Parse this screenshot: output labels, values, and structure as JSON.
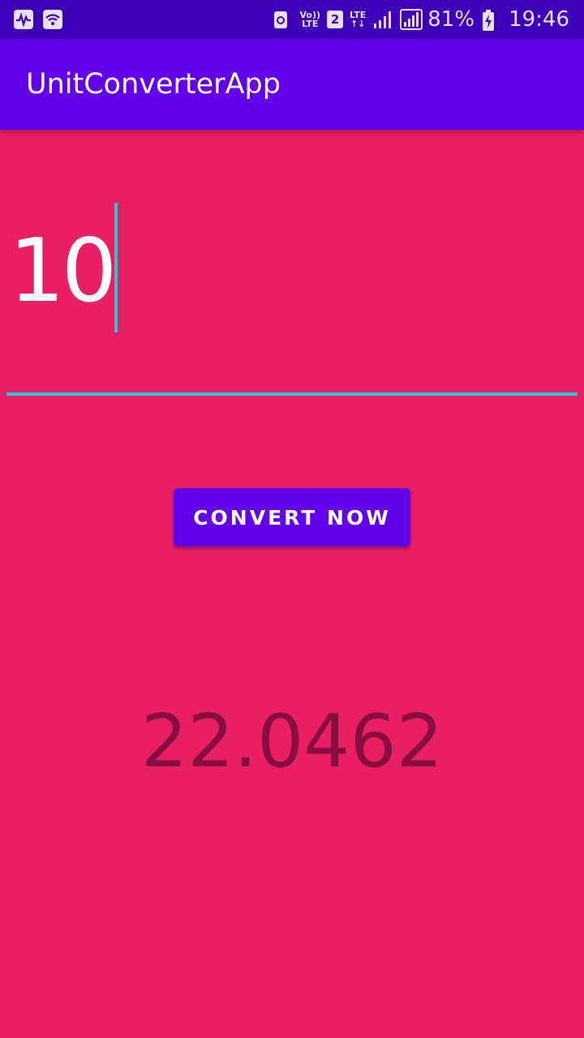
{
  "status_bar": {
    "left_icons": [
      "activity-icon",
      "wifi-icon"
    ],
    "volte_label_top": "Vo))",
    "volte_label_bottom": "LTE",
    "sim_number": "2",
    "lte_label": "LTE",
    "battery_percent": "81%",
    "time": "19:46"
  },
  "app_bar": {
    "title": "UnitConverterApp"
  },
  "input": {
    "value": "10"
  },
  "button": {
    "label": "CONVERT NOW"
  },
  "result": {
    "value": "22.0462"
  },
  "colors": {
    "background": "#E91E63",
    "primary": "#6200EE",
    "primary_dark": "#3D00B8",
    "accent": "#26C6DA",
    "result_text": "#880E3F"
  }
}
